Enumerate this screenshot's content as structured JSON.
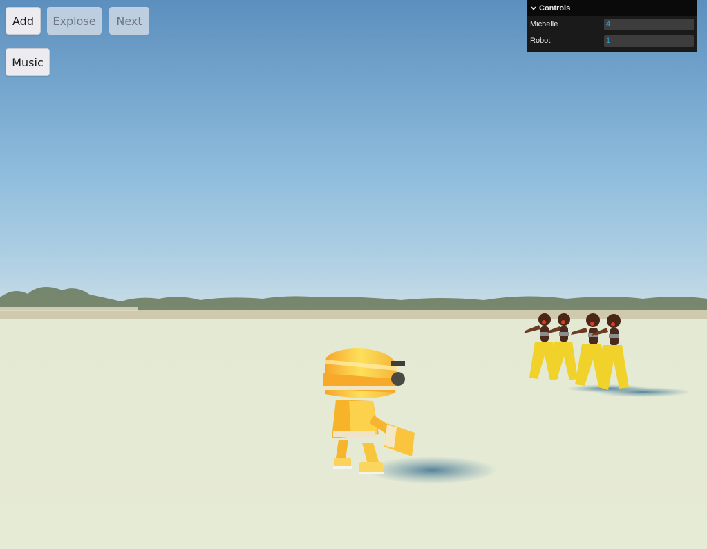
{
  "buttons": {
    "add": "Add",
    "explode": "Explose",
    "next": "Next",
    "music": "Music"
  },
  "controls": {
    "title": "Controls",
    "rows": [
      {
        "label": "Michelle",
        "value": "4"
      },
      {
        "label": "Robot",
        "value": "1"
      }
    ]
  },
  "scene": {
    "sky_top": "#5f94c3",
    "sky_horizon": "#b6d3e6",
    "ground": "#e5ead4",
    "robot_color": "#f5c430",
    "dancer_pants": "#f0d22a",
    "shadow": "#5d8aa0",
    "dancer_count": 4,
    "robot_count": 1
  },
  "icons": {
    "collapse": "chevron-down-icon"
  }
}
